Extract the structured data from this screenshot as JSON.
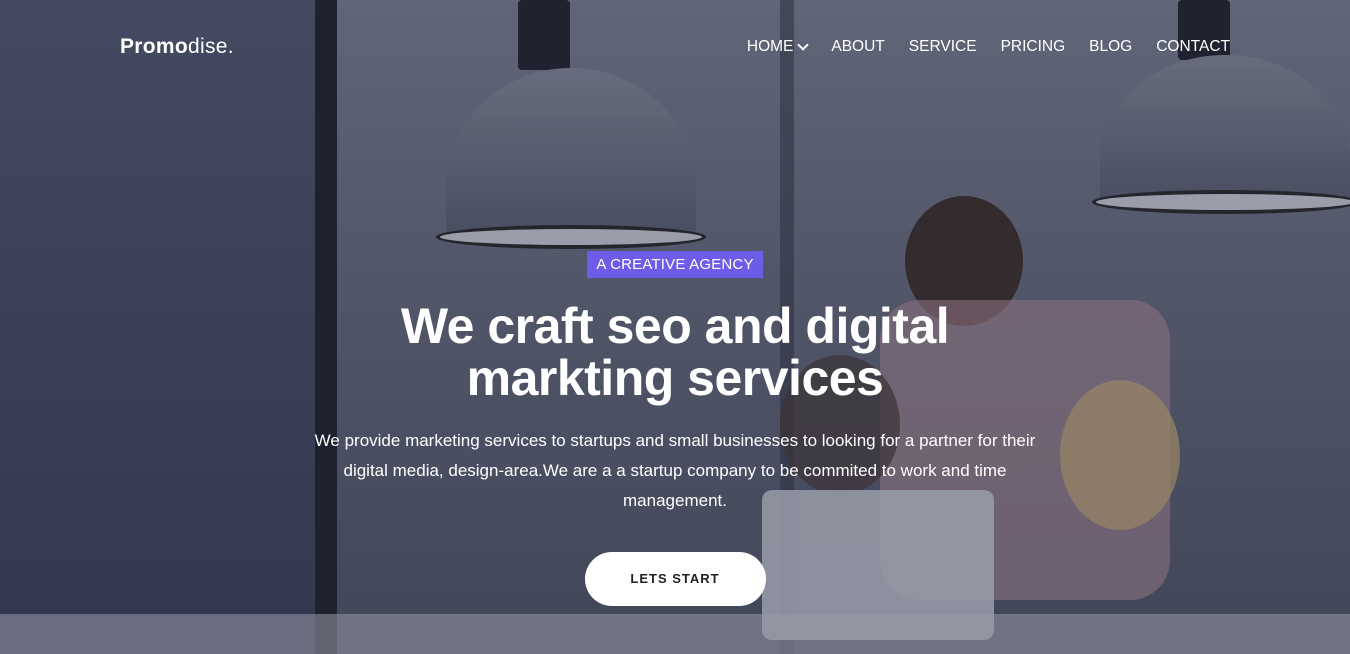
{
  "brand": {
    "name_bold": "Promo",
    "name_regular": "dise."
  },
  "nav": {
    "items": [
      {
        "label": "HOME",
        "has_dropdown": true
      },
      {
        "label": "ABOUT"
      },
      {
        "label": "SERVICE"
      },
      {
        "label": "PRICING"
      },
      {
        "label": "BLOG"
      },
      {
        "label": "CONTACT"
      }
    ]
  },
  "hero": {
    "badge": "A CREATIVE AGENCY",
    "headline": "We craft seo and digital markting services",
    "description": "We provide marketing services to startups and small businesses to looking for a partner for their digital media, design-area.We are a a startup company to be commited to work and time management.",
    "cta_label": "LETS START"
  },
  "colors": {
    "accent": "#6c5ce7",
    "text": "#ffffff",
    "button_bg": "#ffffff"
  }
}
